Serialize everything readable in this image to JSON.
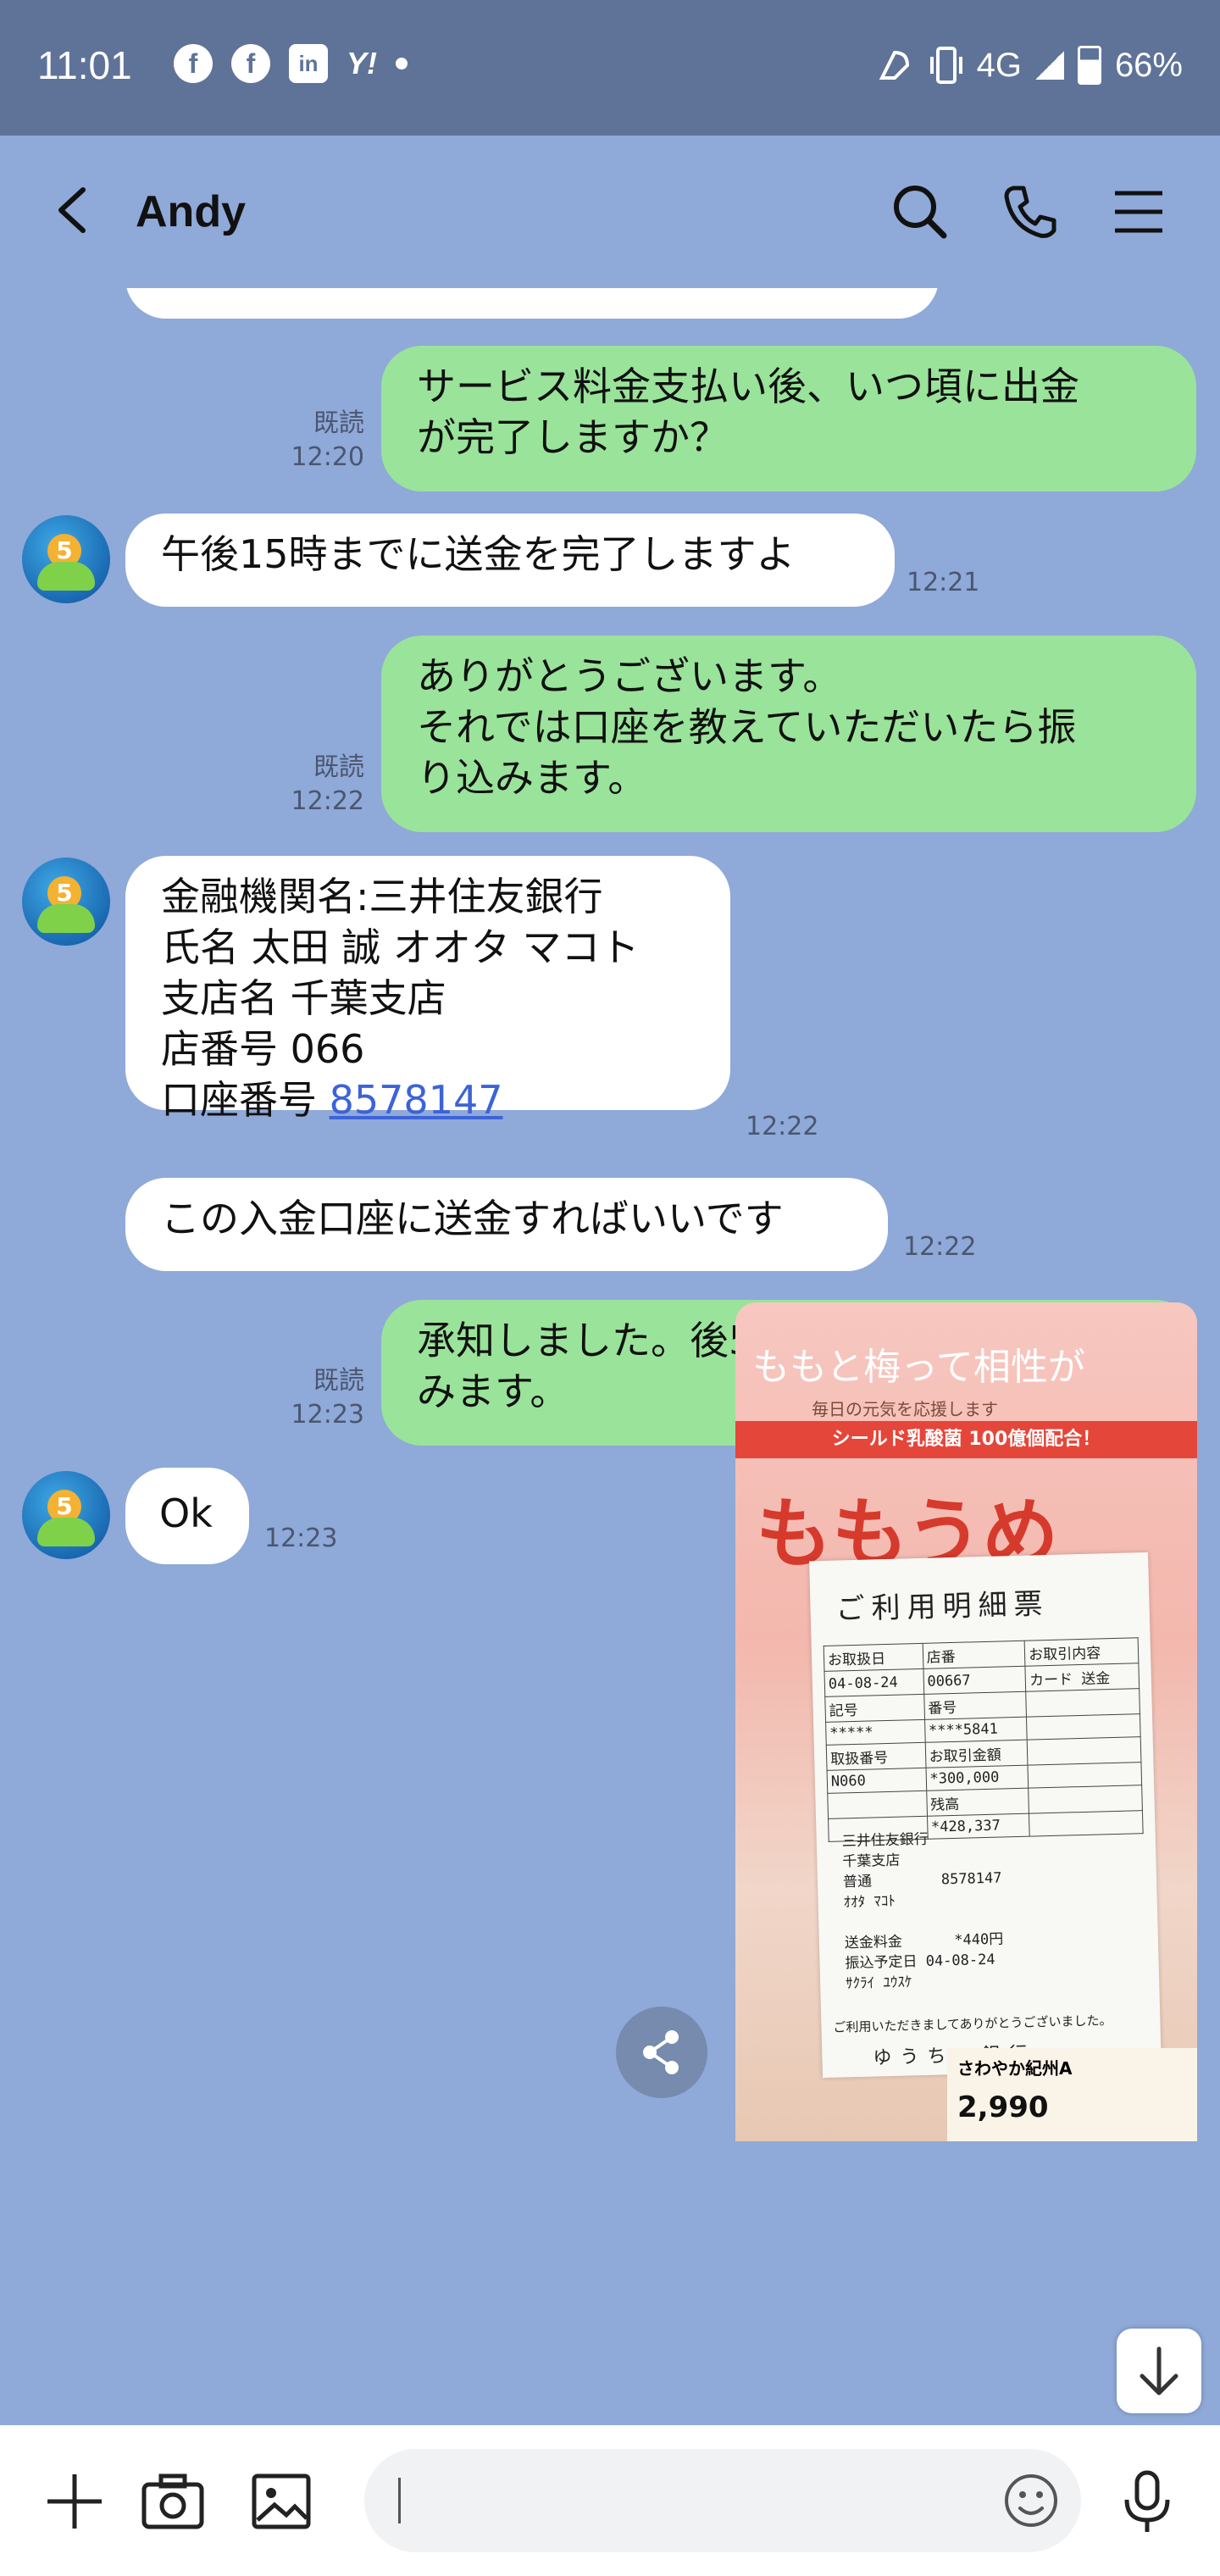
{
  "status_bar": {
    "time": "11:01",
    "apps": [
      "facebook-icon",
      "facebook-icon",
      "linkedin-icon",
      "yahoo-icon"
    ],
    "network": "4G",
    "battery": "66%"
  },
  "header": {
    "contact_name": "Andy"
  },
  "messages": [
    {
      "id": "m1",
      "side": "out",
      "read_label": "既読",
      "time": "12:20",
      "text": "サービス料金支払い後、いつ頃に出金\nが完了しますか？"
    },
    {
      "id": "m2",
      "side": "in",
      "time": "12:21",
      "text": "午後15時までに送金を完了しますよ"
    },
    {
      "id": "m3",
      "side": "out",
      "read_label": "既読",
      "time": "12:22",
      "text": "ありがとうございます。\nそれでは口座を教えていただいたら振\nり込みます。"
    },
    {
      "id": "m4",
      "side": "in",
      "time": "12:22",
      "lines": [
        "金融機関名:三井住友銀行",
        "氏名 太田 誠 オオタ マコト",
        "支店名 千葉支店",
        "店番号 066"
      ],
      "account_label": "口座番号 ",
      "account_number": "8578147"
    },
    {
      "id": "m5",
      "side": "in",
      "time": "12:22",
      "text": "この入金口座に送金すればいいです"
    },
    {
      "id": "m6",
      "side": "out",
      "read_label": "既読",
      "time": "12:23",
      "text": "承知しました。後5分くらいで振り込\nみます。"
    },
    {
      "id": "m7",
      "side": "in",
      "time": "12:23",
      "text": "Ok"
    }
  ],
  "photo": {
    "top_text": "ももと梅って相性が",
    "sub_text": "毎日の元気を応援します",
    "band_text": "シールド乳酸菌 100億個配合！",
    "brand": "ももうめ",
    "receipt": {
      "title": "ご利用明細票",
      "rows": [
        [
          "お取扱日",
          "店番",
          "お取引内容"
        ],
        [
          "04-08-24",
          "00667",
          "カード 送金"
        ],
        [
          "記号",
          "番号",
          ""
        ],
        [
          "*****",
          "****5841",
          ""
        ],
        [
          "取扱番号",
          "お取引金額",
          ""
        ],
        [
          "N060",
          "*300,000",
          ""
        ],
        [
          "",
          "残高",
          ""
        ],
        [
          "",
          "*428,337",
          ""
        ]
      ],
      "detail_lines": "三井住友銀行\n千葉支店\n普通        8578147\nｵｵﾀ ﾏｺﾄ\n\n送金料金      *440円\n振込予定日 04-08-24\nｻｸﾗｲ ﾕｳｽｹ",
      "footer": "ご利用いただきましてありがとうございました。",
      "bank": "ゆうちょ銀行"
    },
    "shelf_label": "さわやか紀州A",
    "price": "2,990"
  },
  "input": {
    "placeholder": ""
  },
  "colors": {
    "background": "#8fa9d8",
    "outgoing_bubble": "#9ae39a",
    "incoming_bubble": "#ffffff",
    "link": "#3c63d8"
  }
}
